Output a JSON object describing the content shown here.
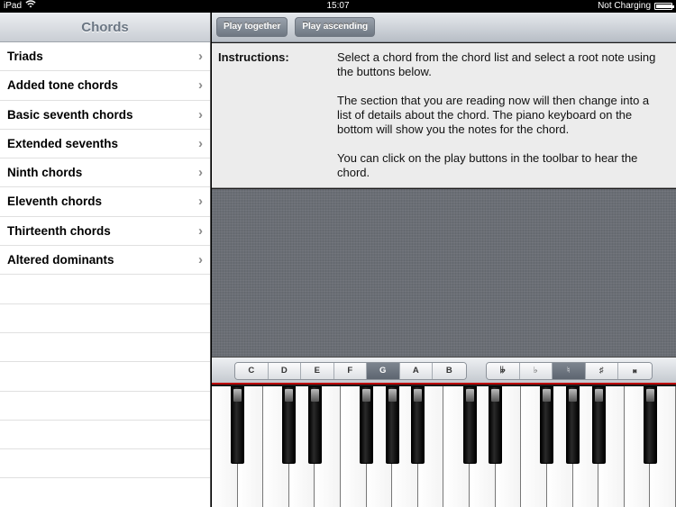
{
  "status_bar": {
    "device": "iPad",
    "time": "15:07",
    "charging": "Not Charging"
  },
  "sidebar": {
    "title": "Chords",
    "items": [
      {
        "label": "Triads"
      },
      {
        "label": "Added tone chords"
      },
      {
        "label": "Basic seventh chords"
      },
      {
        "label": "Extended sevenths"
      },
      {
        "label": "Ninth chords"
      },
      {
        "label": "Eleventh chords"
      },
      {
        "label": "Thirteenth chords"
      },
      {
        "label": "Altered dominants"
      }
    ],
    "chevron": "›"
  },
  "toolbar": {
    "play_together": "Play together",
    "play_ascending": "Play ascending"
  },
  "instructions": {
    "label": "Instructions:",
    "paragraphs": [
      "Select a chord from the chord list and select a root note using the buttons below.",
      "The section that you are reading now will then change into a list of details about the chord. The piano keyboard on the bottom will show you the notes for the chord.",
      "You can click on the play buttons in the toolbar to hear the chord."
    ]
  },
  "notes": {
    "options": [
      "C",
      "D",
      "E",
      "F",
      "G",
      "A",
      "B"
    ],
    "selected": "G"
  },
  "accidentals": {
    "options": [
      "𝄫",
      "♭",
      "♮",
      "♯",
      "𝄪"
    ],
    "selected": "♮"
  },
  "colors": {
    "accent_red": "#bb0000",
    "selected_segment": "#6a727c"
  }
}
